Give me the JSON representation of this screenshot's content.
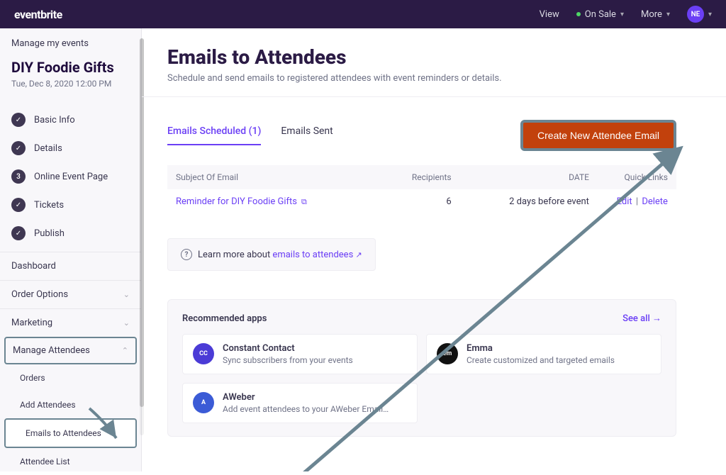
{
  "topnav": {
    "logo": "eventbrite",
    "view": "View",
    "status": "On Sale",
    "more": "More",
    "avatar_initials": "NE"
  },
  "sidebar": {
    "manage_label": "Manage my events",
    "event_title": "DIY Foodie Gifts",
    "event_date": "Tue, Dec 8, 2020 12:00 PM",
    "steps": [
      {
        "label": "Basic Info",
        "icon": "check"
      },
      {
        "label": "Details",
        "icon": "check"
      },
      {
        "label": "Online Event Page",
        "icon": "3"
      },
      {
        "label": "Tickets",
        "icon": "check"
      },
      {
        "label": "Publish",
        "icon": "check"
      }
    ],
    "sections": {
      "dashboard": "Dashboard",
      "order_options": "Order Options",
      "marketing": "Marketing",
      "manage_attendees": "Manage Attendees"
    },
    "sub_items": {
      "orders": "Orders",
      "add_attendees": "Add Attendees",
      "emails_to_attendees": "Emails to Attendees",
      "attendee_list": "Attendee List"
    }
  },
  "page": {
    "title": "Emails to Attendees",
    "subtitle": "Schedule and send emails to registered attendees with event reminders or details."
  },
  "tabs": {
    "scheduled": "Emails Scheduled (1)",
    "sent": "Emails Sent"
  },
  "create_button": "Create New Attendee Email",
  "table": {
    "headers": {
      "subject": "Subject Of Email",
      "recipients": "Recipients",
      "date": "DATE",
      "links": "Quick Links"
    },
    "rows": [
      {
        "subject": "Reminder for DIY Foodie Gifts",
        "recipients": "6",
        "date": "2 days before event",
        "edit": "Edit",
        "delete": "Delete"
      }
    ]
  },
  "help": {
    "prefix": "Learn more about ",
    "link": "emails to attendees"
  },
  "apps": {
    "title": "Recommended apps",
    "see_all": "See all",
    "items": [
      {
        "name": "Constant Contact",
        "desc": "Sync subscribers from your events",
        "bg": "#4b3bd6",
        "ini": "CC"
      },
      {
        "name": "Emma",
        "desc": "Create customized and targeted emails",
        "bg": "#111111",
        "ini": "em"
      },
      {
        "name": "AWeber",
        "desc": "Add event attendees to your AWeber Email…",
        "bg": "#3b5bd6",
        "ini": "A"
      }
    ]
  }
}
